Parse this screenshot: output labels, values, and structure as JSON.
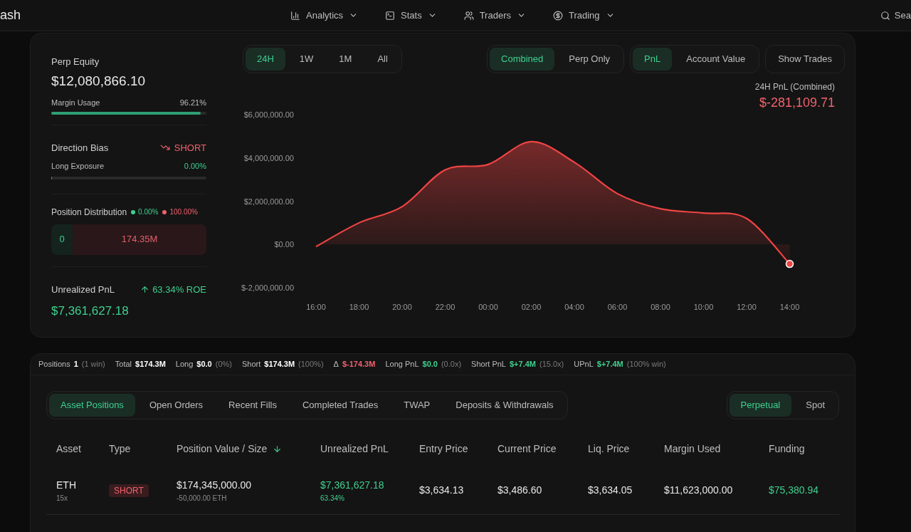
{
  "nav": {
    "logo": "ash",
    "menus": [
      {
        "label": "Analytics"
      },
      {
        "label": "Stats"
      },
      {
        "label": "Traders"
      },
      {
        "label": "Trading"
      }
    ],
    "search": "Sea"
  },
  "summary": {
    "equity_label": "Perp Equity",
    "equity": "$12,080,866.10",
    "margin": {
      "label": "Margin Usage",
      "value": "96.21%",
      "level": 0.9621
    },
    "bias_label": "Direction Bias",
    "bias": "SHORT",
    "long_exposure": {
      "label": "Long Exposure",
      "value": "0.00%",
      "level": 0
    },
    "distribution_label": "Position Distribution",
    "long_share": "0.00%",
    "short_share": "100.00%",
    "long_amount": "0",
    "short_amount": "174.35M",
    "upnl_label": "Unrealized PnL",
    "roe": "63.34% ROE",
    "upnl": "$7,361,627.18"
  },
  "range_tabs": [
    {
      "label": "24H",
      "selected": true
    },
    {
      "label": "1W",
      "selected": false
    },
    {
      "label": "1M",
      "selected": false
    },
    {
      "label": "All",
      "selected": false
    }
  ],
  "scope_tabs": [
    {
      "label": "Combined",
      "selected": true
    },
    {
      "label": "Perp Only",
      "selected": false
    }
  ],
  "metric_tabs": [
    {
      "label": "PnL",
      "selected": true
    },
    {
      "label": "Account Value",
      "selected": false
    }
  ],
  "show_trades": "Show Trades",
  "pnl_title": "24H PnL (Combined)",
  "pnl_value": "$-281,109.71",
  "chart_data": {
    "type": "area",
    "categories": [
      "16:00",
      "18:00",
      "20:00",
      "22:00",
      "00:00",
      "02:00",
      "04:00",
      "06:00",
      "08:00",
      "10:00",
      "12:00",
      "14:00"
    ],
    "series": [
      {
        "color": "#ef4444",
        "values": [
          -100000,
          1000000,
          1750000,
          3450000,
          3700000,
          4750000,
          3800000,
          2350000,
          1650000,
          1450000,
          1200000,
          -900000
        ]
      }
    ],
    "ylim": [
      -2000000,
      6000000
    ],
    "yticks": [
      {
        "value": 6000000,
        "label": "$6,000,000.00"
      },
      {
        "value": 4000000,
        "label": "$4,000,000.00"
      },
      {
        "value": 2000000,
        "label": "$2,000,000.00"
      },
      {
        "value": 0,
        "label": "$0.00"
      },
      {
        "value": -2000000,
        "label": "$-2,000,000.00"
      }
    ]
  },
  "stats_bar": [
    {
      "label": "Positions",
      "value": "1",
      "note": "(1 win)",
      "color": "#ffffff"
    },
    {
      "label": "Total",
      "value": "$174.3M",
      "color": "#ffffff"
    },
    {
      "label": "Long",
      "value": "$0.0",
      "note": "(0%)",
      "color": "#ffffff"
    },
    {
      "label": "Short",
      "value": "$174.3M",
      "note": "(100%)",
      "color": "#ffffff"
    },
    {
      "label": "Δ",
      "value": "$-174.3M",
      "color": "#f0616d"
    },
    {
      "label": "Long PnL",
      "value": "$0.0",
      "note": "(0.0x)",
      "color": "#3fcf8e"
    },
    {
      "label": "Short PnL",
      "value": "$+7.4M",
      "note": "(15.0x)",
      "color": "#3fcf8e"
    },
    {
      "label": "UPnL",
      "value": "$+7.4M",
      "note": "(100% win)",
      "color": "#3fcf8e"
    }
  ],
  "position_tabs": [
    {
      "label": "Asset Positions",
      "selected": true
    },
    {
      "label": "Open Orders",
      "selected": false
    },
    {
      "label": "Recent Fills",
      "selected": false
    },
    {
      "label": "Completed Trades",
      "selected": false
    },
    {
      "label": "TWAP",
      "selected": false
    },
    {
      "label": "Deposits & Withdrawals",
      "selected": false
    }
  ],
  "market_tabs": [
    {
      "label": "Perpetual",
      "selected": true
    },
    {
      "label": "Spot",
      "selected": false
    }
  ],
  "table": {
    "columns": [
      {
        "label": "Asset",
        "sorted": false
      },
      {
        "label": "Type",
        "sorted": false
      },
      {
        "label": "Position Value / Size",
        "sorted": true
      },
      {
        "label": "Unrealized PnL",
        "sorted": false
      },
      {
        "label": "Entry Price",
        "sorted": false
      },
      {
        "label": "Current Price",
        "sorted": false
      },
      {
        "label": "Liq. Price",
        "sorted": false
      },
      {
        "label": "Margin Used",
        "sorted": false
      },
      {
        "label": "Funding",
        "sorted": false
      }
    ],
    "rows": [
      {
        "asset": "ETH",
        "leverage": "15x",
        "type": "SHORT",
        "value": "$174,345,000.00",
        "size": "-50,000.00 ETH",
        "pnl": "$7,361,627.18",
        "pnl_pct": "63.34%",
        "entry": "$3,634.13",
        "current": "$3,486.60",
        "liq": "$3,634.05",
        "margin": "$11,623,000.00",
        "funding": "$75,380.94"
      }
    ]
  }
}
